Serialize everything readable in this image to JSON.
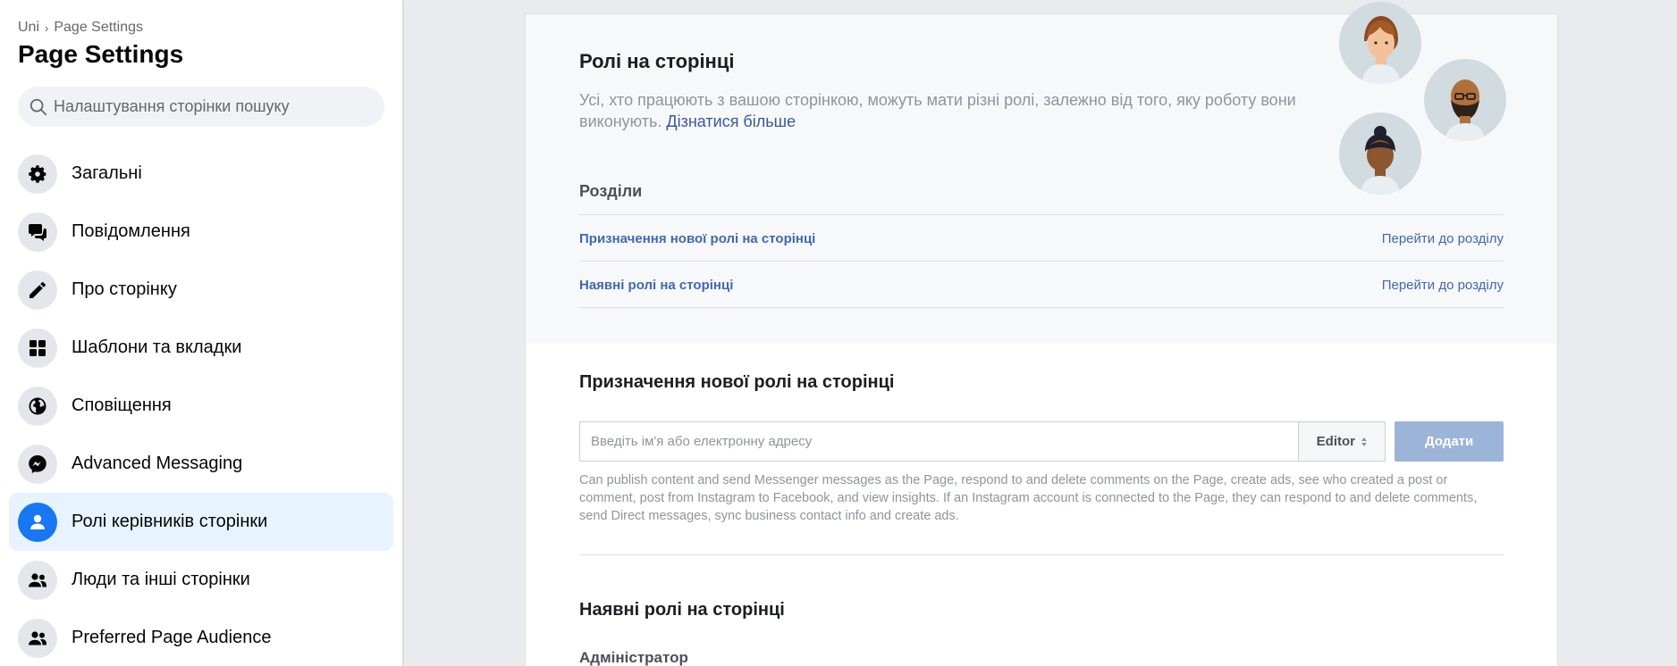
{
  "sidebar": {
    "breadcrumb": {
      "parent": "Uni",
      "separator": "›",
      "current": "Page Settings"
    },
    "title": "Page Settings",
    "search_placeholder": "Налаштування сторінки пошуку",
    "items": [
      {
        "label": "Загальні",
        "icon": "gear-icon"
      },
      {
        "label": "Повідомлення",
        "icon": "chat-bubbles-icon"
      },
      {
        "label": "Про сторінку",
        "icon": "pencil-icon"
      },
      {
        "label": "Шаблони та вкладки",
        "icon": "grid-icon"
      },
      {
        "label": "Сповіщення",
        "icon": "globe-icon"
      },
      {
        "label": "Advanced Messaging",
        "icon": "messenger-icon"
      },
      {
        "label": "Ролі керівників сторінки",
        "icon": "person-icon",
        "active": true
      },
      {
        "label": "Люди та інші сторінки",
        "icon": "people-icon"
      },
      {
        "label": "Preferred Page Audience",
        "icon": "people-icon"
      }
    ]
  },
  "main": {
    "roles_title": "Ролі на сторінці",
    "roles_description": "Усі, хто працюють з вашою сторінкою, можуть мати різні ролі, залежно від того, яку роботу вони виконують.",
    "learn_more": "Дізнатися більше",
    "sections_title": "Розділи",
    "sections": [
      {
        "label": "Призначення нової ролі на сторінці",
        "go": "Перейти до розділу"
      },
      {
        "label": "Наявні ролі на сторінці",
        "go": "Перейти до розділу"
      }
    ],
    "assign": {
      "title": "Призначення нової ролі на сторінці",
      "input_placeholder": "Введіть ім'я або електронну адресу",
      "role_value": "Editor",
      "add_button": "Додати",
      "help_text": "Can publish content and send Messenger messages as the Page, respond to and delete comments on the Page, create ads, see who created a post or comment, post from Instagram to Facebook, and view insights. If an Instagram account is connected to the Page, they can respond to and delete comments, send Direct messages, sync business contact info and create ads."
    },
    "existing_title": "Наявні ролі на сторінці",
    "admin_label": "Адміністратор"
  },
  "colors": {
    "accent": "#1877f2",
    "link": "#4267b2",
    "add_button_disabled": "#9cb4d8",
    "active_item_bg": "#e7f3ff"
  }
}
